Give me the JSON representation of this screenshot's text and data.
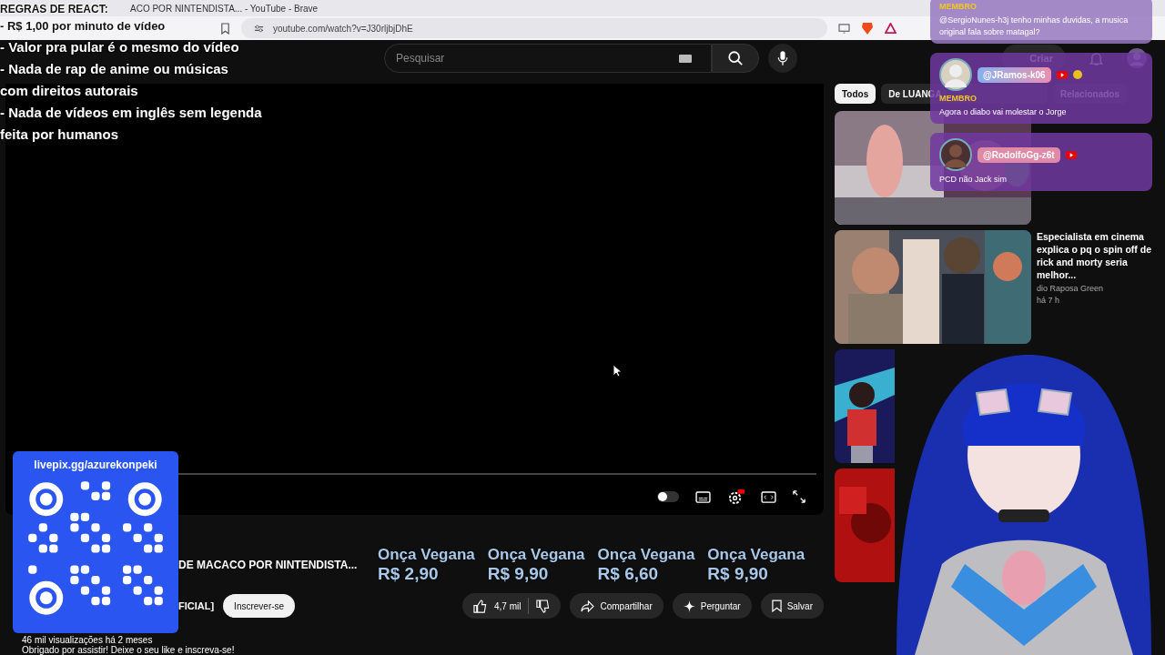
{
  "browser": {
    "title": "ACO POR NINTENDISTA... - YouTube - Brave",
    "url": "youtube.com/watch?v=J30rljbjDhE"
  },
  "masthead": {
    "search": {
      "placeholder": "Pesquisar"
    },
    "create": "Criar"
  },
  "chips": [
    {
      "label": "Todos",
      "selected": true
    },
    {
      "label": "De LUANGA",
      "selected": false
    },
    {
      "label": "Relacionados",
      "selected": false
    }
  ],
  "sidebar_videos": [
    {
      "title": "Especialista em cinema explica o pq o spin off de rick and morty seria melhor...",
      "channel": "dio Raposa Green",
      "meta": "há 7 h"
    }
  ],
  "video": {
    "title": "DE MACACO POR NINTENDISTA...",
    "channel": "FICIAL]",
    "subscribe": "Inscrever-se",
    "likes": "4,7 mil",
    "actions": [
      "Compartilhar",
      "Perguntar",
      "Salvar"
    ],
    "views": "46 mil visualizações  há 2 meses",
    "description": "Obrigado por assistir! Deixe o seu like e inscreva-se!"
  },
  "rules": {
    "title": "REGRAS DE REACT:",
    "lines": [
      "- R$ 1,00 por minuto de vídeo",
      "- Valor pra pular é o mesmo do vídeo",
      "- Nada de rap de anime ou músicas",
      "com direitos autorais",
      "- Nada de vídeos em inglês sem legenda",
      "feita por humanos"
    ]
  },
  "chat": [
    {
      "label": "MEMBRO",
      "text": "@SergioNunes-h3j tenho minhas duvidas, a musica original fala sobre matagal?"
    },
    {
      "user": "@JRamos-k06",
      "label": "MEMBRO",
      "text": "Agora o diabo vai molestar o Jorge"
    },
    {
      "user": "@RodolfoGg-z6t",
      "text": "PCD não Jack sim"
    }
  ],
  "ticker": [
    {
      "name": "Onça Vegana",
      "price": "R$ 2,90"
    },
    {
      "name": "Onça Vegana",
      "price": "R$ 9,90"
    },
    {
      "name": "Onça Vegana",
      "price": "R$ 6,60"
    },
    {
      "name": "Onça Vegana",
      "price": "R$ 9,90"
    }
  ],
  "donation": {
    "url": "livepix.gg/azurekonpeki"
  }
}
